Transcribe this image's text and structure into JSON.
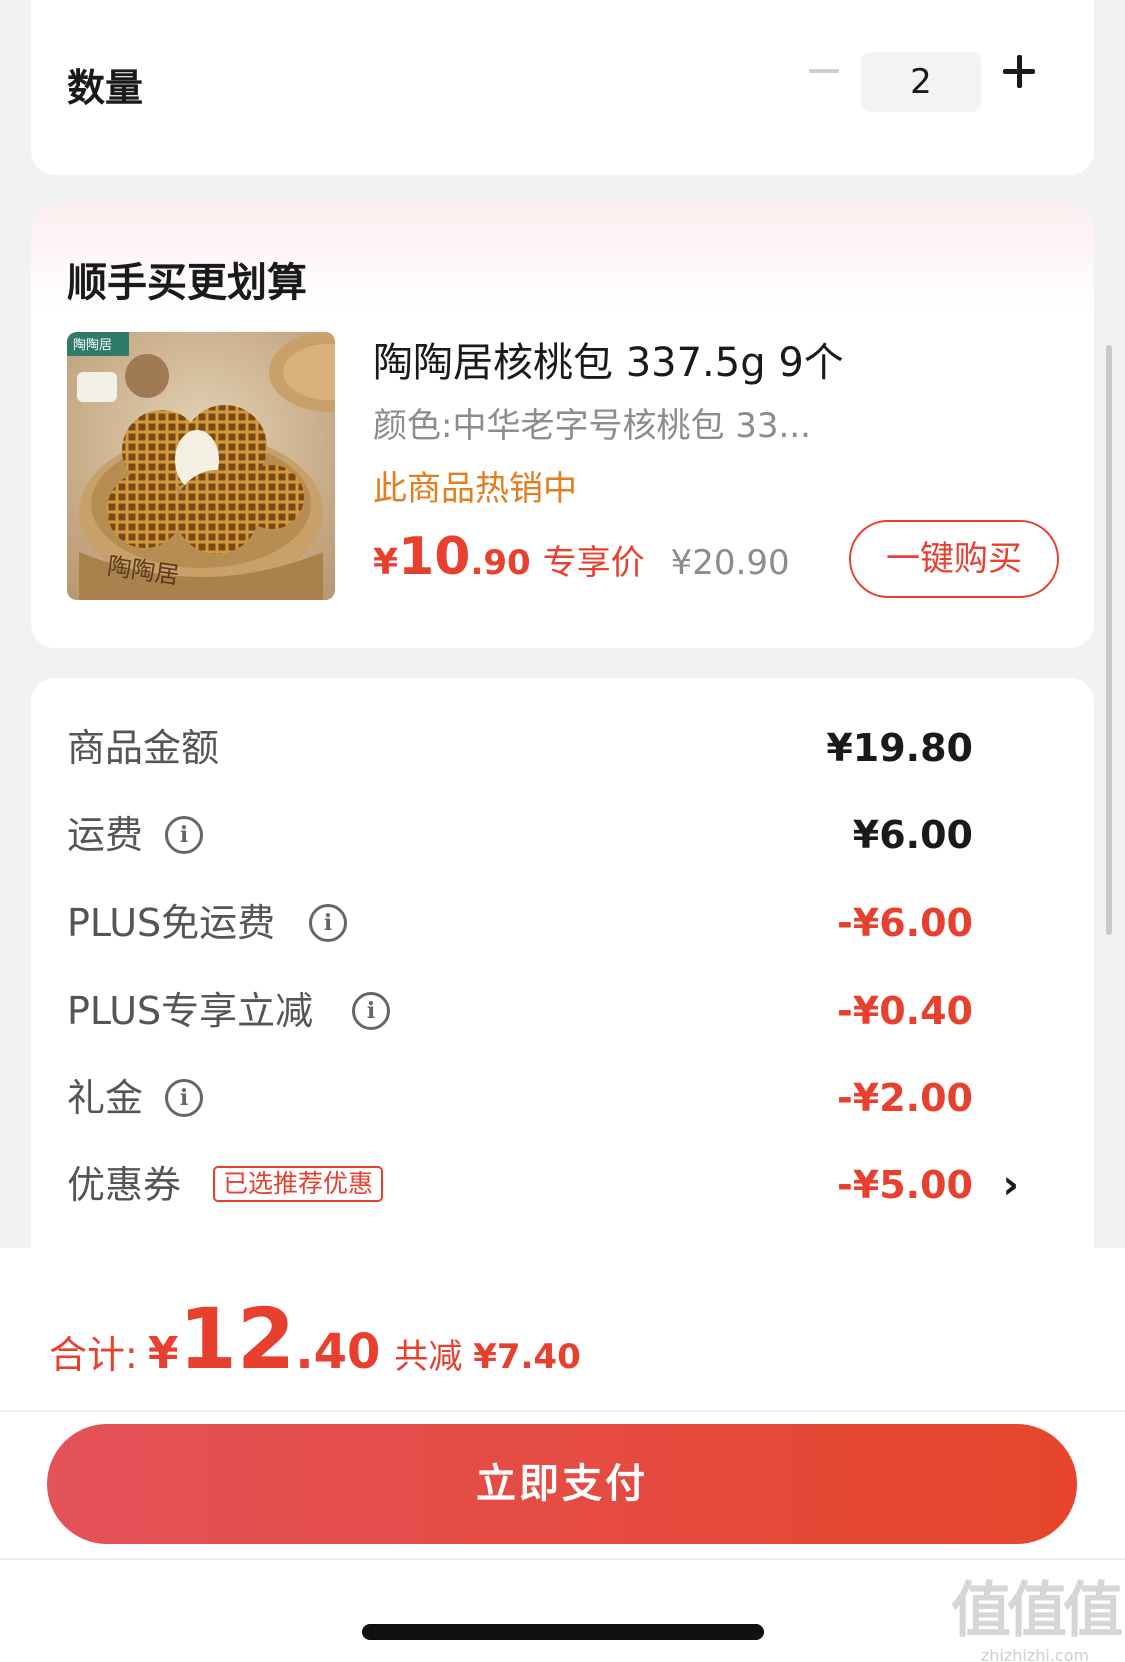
{
  "quantity": {
    "label": "数量",
    "value": "2"
  },
  "upsell": {
    "title": "顺手买更划算",
    "product": {
      "image_brand": "陶陶居",
      "name": "陶陶居核桃包 337.5g 9个",
      "spec": "颜色:中华老字号核桃包 33...",
      "hot_text": "此商品热销中",
      "price_currency": "¥",
      "price_int": "10",
      "price_dec": ".90",
      "price_tag": "专享价",
      "original_price": "¥20.90",
      "buy_label": "一键购买"
    }
  },
  "summary": {
    "rows": [
      {
        "label": "商品金额",
        "value": "¥19.80"
      },
      {
        "label": "运费",
        "value": "¥6.00"
      },
      {
        "label": "PLUS免运费",
        "value": "-¥6.00"
      },
      {
        "label": "PLUS专享立减",
        "value": "-¥0.40"
      },
      {
        "label": "礼金",
        "value": "-¥2.00"
      },
      {
        "label": "优惠券",
        "badge": "已选推荐优惠",
        "value": "-¥5.00"
      }
    ]
  },
  "checkout": {
    "total_label": "合计:",
    "total_currency": "¥",
    "total_int": "12",
    "total_dec": ".40",
    "save_label": "共减",
    "save_value": "¥7.40",
    "pay_label": "立即支付"
  },
  "watermark": {
    "big": "值值值",
    "small": "zhizhizhi.com"
  },
  "colors": {
    "accent_red": "#e8402f",
    "hot_orange": "#e37d1e",
    "background": "#f2f2f2"
  }
}
